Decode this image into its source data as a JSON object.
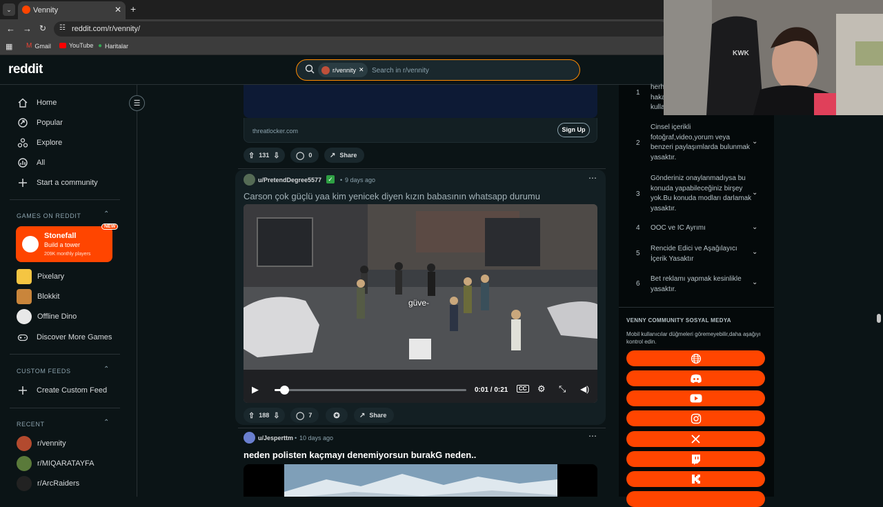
{
  "browser": {
    "tab_title": "Vennity",
    "url": "reddit.com/r/vennity/",
    "bookmarks": [
      "Gmail",
      "YouTube",
      "Haritalar"
    ]
  },
  "reddit": {
    "logo": "reddit",
    "search": {
      "community_chip": "r/vennity",
      "placeholder": "Search in r/vennity"
    }
  },
  "sidebar": {
    "nav": [
      {
        "label": "Home",
        "icon": "home-icon"
      },
      {
        "label": "Popular",
        "icon": "popular-icon"
      },
      {
        "label": "Explore",
        "icon": "explore-icon"
      },
      {
        "label": "All",
        "icon": "all-icon"
      },
      {
        "label": "Start a community",
        "icon": "plus-icon"
      }
    ],
    "games_header": "GAMES ON REDDIT",
    "featured_game": {
      "name": "Stonefall",
      "tagline": "Build a tower",
      "players": "209K monthly players",
      "badge": "NEW"
    },
    "games": [
      "Pixelary",
      "Blokkit",
      "Offline Dino",
      "Discover More Games"
    ],
    "custom_feeds_header": "CUSTOM FEEDS",
    "create_custom_feed": "Create Custom Feed",
    "recent_header": "RECENT",
    "recent": [
      "r/vennity",
      "r/MIQARATAYFA",
      "r/ArcRaiders"
    ]
  },
  "feed": {
    "ad": {
      "domain": "threatlocker.com",
      "cta": "Sign Up",
      "votes": "131",
      "comments": "0",
      "share": "Share"
    },
    "post1": {
      "author": "u/PretendDegree5577",
      "time": "9 days ago",
      "title": "Carson çok güçlü yaa kim yenicek diyen kızın babasının whatsapp durumu",
      "caption": "güve-",
      "video_time": "0:01 / 0:21",
      "video_progress": 0.05,
      "votes": "188",
      "comments": "7",
      "share": "Share"
    },
    "post2": {
      "author": "u/Jesperttm",
      "time": "10 days ago",
      "title": "neden polisten kaçmayı denemiyorsun burakG neden.."
    }
  },
  "rules": [
    {
      "num": "1",
      "text": "herh haka kulla"
    },
    {
      "num": "2",
      "text": "Cinsel içerikli fotoğraf,video,yorum veya benzeri paylaşımlarda bulunmak yasaktır."
    },
    {
      "num": "3",
      "text": "Gönderiniz onaylanmadıysa bu konuda yapabileceğiniz birşey yok.Bu konuda modları darlamak yasaktır."
    },
    {
      "num": "4",
      "text": "OOC ve IC Ayrımı"
    },
    {
      "num": "5",
      "text": "Rencide Edici ve Aşağılayıcı İçerik Yasaktır"
    },
    {
      "num": "6",
      "text": "Bet reklamı yapmak kesinlikle yasaktır."
    }
  ],
  "social": {
    "header": "VENNY COMMUNITY SOSYAL MEDYA",
    "description": "Mobil kullanıcılar düğmeleri göremeyebilir,daha aşağıyı kontrol edin.",
    "buttons": [
      "globe-icon",
      "discord-icon",
      "youtube-icon",
      "instagram-icon",
      "x-icon",
      "twitch-icon",
      "kick-icon"
    ]
  },
  "colors": {
    "accent": "#ff4500",
    "search_border": "#ff8a00",
    "background": "#0b1416"
  }
}
